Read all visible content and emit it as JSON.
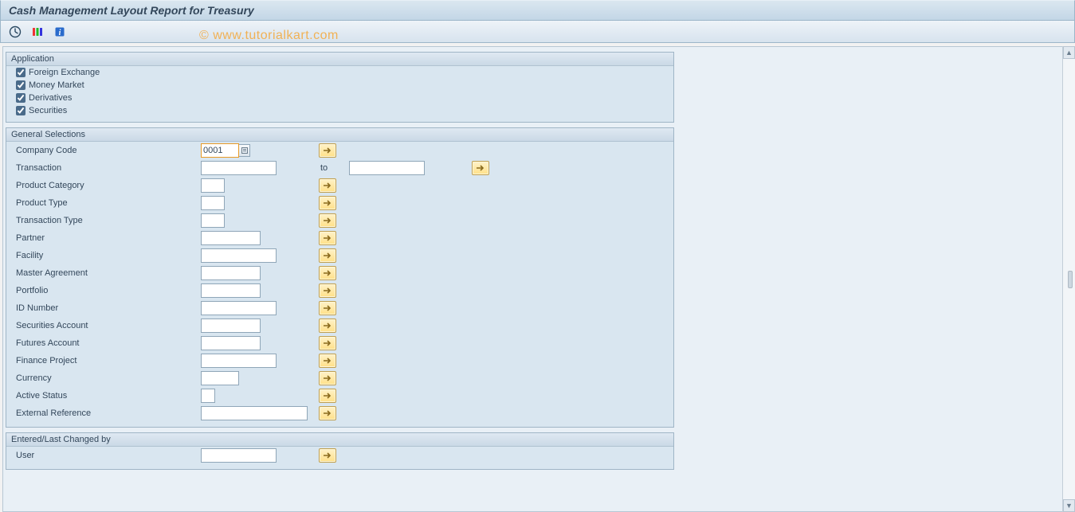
{
  "title": "Cash Management Layout Report for Treasury",
  "watermark": "© www.tutorialkart.com",
  "toolbar": {
    "execute_icon": "execute",
    "variants_icon": "variants",
    "info_icon": "info"
  },
  "groups": {
    "application": {
      "title": "Application",
      "items": [
        {
          "label": "Foreign Exchange",
          "checked": true
        },
        {
          "label": "Money Market",
          "checked": true
        },
        {
          "label": "Derivatives",
          "checked": true
        },
        {
          "label": "Securities",
          "checked": true
        }
      ]
    },
    "general": {
      "title": "General Selections",
      "fields": {
        "company_code": {
          "label": "Company Code",
          "value": "0001"
        },
        "transaction": {
          "label": "Transaction",
          "to_label": "to"
        },
        "product_category": {
          "label": "Product Category"
        },
        "product_type": {
          "label": "Product Type"
        },
        "transaction_type": {
          "label": "Transaction Type"
        },
        "partner": {
          "label": "Partner"
        },
        "facility": {
          "label": "Facility"
        },
        "master_agreement": {
          "label": "Master Agreement"
        },
        "portfolio": {
          "label": "Portfolio"
        },
        "id_number": {
          "label": "ID Number"
        },
        "securities_account": {
          "label": "Securities Account"
        },
        "futures_account": {
          "label": "Futures Account"
        },
        "finance_project": {
          "label": "Finance Project"
        },
        "currency": {
          "label": "Currency"
        },
        "active_status": {
          "label": "Active Status"
        },
        "external_reference": {
          "label": "External Reference"
        }
      }
    },
    "entered": {
      "title": "Entered/Last Changed by",
      "fields": {
        "user": {
          "label": "User"
        }
      }
    }
  }
}
